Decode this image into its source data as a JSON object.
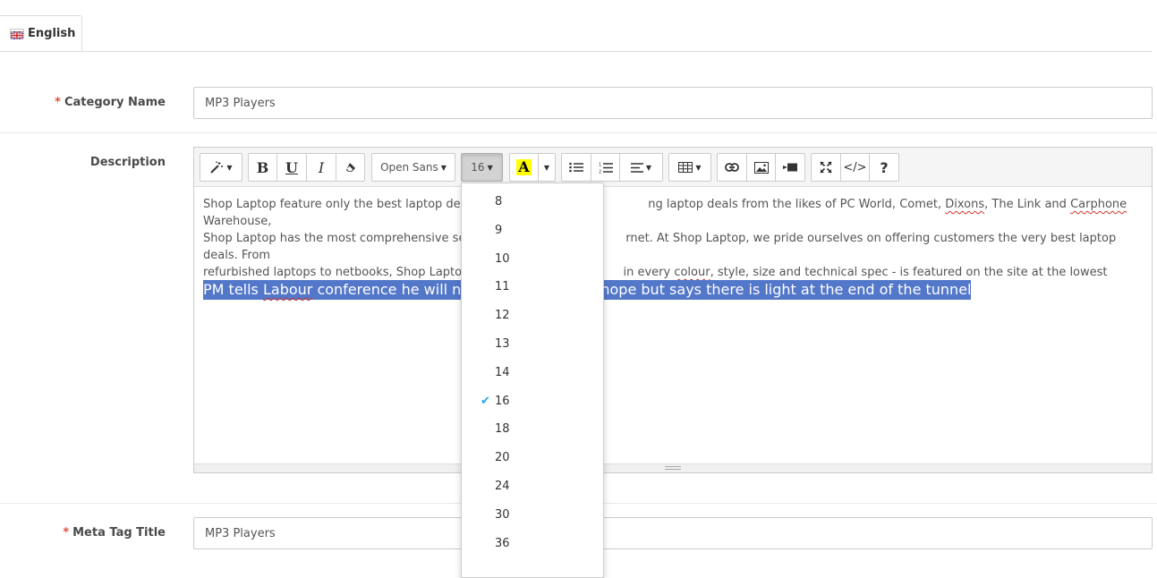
{
  "language_tab": {
    "label": "English",
    "flag_icon": "uk-flag-icon"
  },
  "form": {
    "required_mark": "*",
    "category_name": {
      "label": "Category Name",
      "value": "MP3 Players"
    },
    "description": {
      "label": "Description"
    },
    "meta_tag_title": {
      "label": "Meta Tag Title",
      "value": "MP3 Players"
    }
  },
  "toolbar": {
    "style_icon": "magic-wand-icon",
    "bold": "B",
    "underline": "U",
    "italic": "I",
    "eraser_icon": "eraser-icon",
    "font_family": "Open Sans",
    "font_size": "16",
    "color_letter": "A",
    "color_highlight": "#ffff00",
    "help": "?",
    "codeview": "</>"
  },
  "editor": {
    "paragraph_lines": [
      [
        "Shop Laptop feature only the best laptop deals c",
        "ng laptop deals from the likes of PC World, Comet, ",
        "Dixons",
        ", The Link and ",
        "Carphone",
        " Warehouse,"
      ],
      [
        "Shop Laptop has the most comprehensive selec",
        "rnet. At Shop Laptop, we pride ourselves on offering customers the very best laptop deals. From"
      ],
      [
        "refurbished laptops to netbooks, Shop Laptop e",
        "in every ",
        "colour",
        ", style, size and technical spec - is featured on the site at the lowest possible price."
      ]
    ],
    "selected_parts": [
      "PM tells ",
      "Labour",
      " conference he will not",
      "hope but says there is light at the end of the tunnel"
    ]
  },
  "font_size_menu": {
    "options": [
      "8",
      "9",
      "10",
      "11",
      "12",
      "13",
      "14",
      "16",
      "18",
      "20",
      "24",
      "30",
      "36"
    ],
    "selected": "16"
  },
  "colors": {
    "accent": "#1ea7e6",
    "required": "#e3503e",
    "selection": "#5377c9"
  }
}
